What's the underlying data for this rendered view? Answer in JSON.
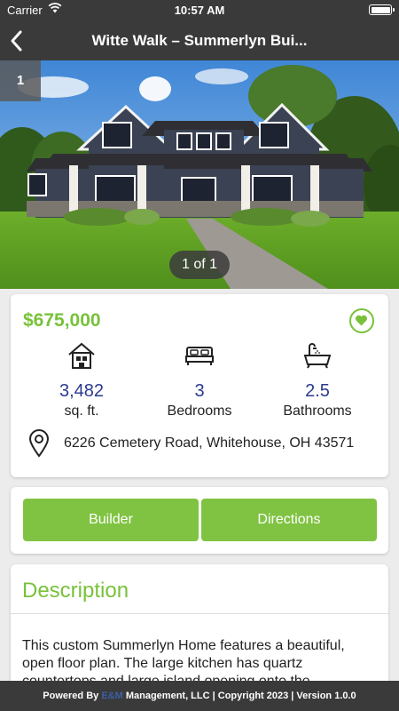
{
  "status_bar": {
    "carrier": "Carrier",
    "time": "10:57 AM"
  },
  "nav": {
    "title": "Witte Walk – Summerlyn Bui..."
  },
  "gallery": {
    "photo_count": "1",
    "pager": "1 of 1"
  },
  "listing": {
    "price": "$675,000",
    "stats": [
      {
        "icon": "house-icon",
        "value": "3,482",
        "label": "sq. ft."
      },
      {
        "icon": "bed-icon",
        "value": "3",
        "label": "Bedrooms"
      },
      {
        "icon": "bathtub-icon",
        "value": "2.5",
        "label": "Bathrooms"
      }
    ],
    "address": "6226 Cemetery Road, Whitehouse, OH 43571"
  },
  "actions": {
    "builder_label": "Builder",
    "directions_label": "Directions"
  },
  "description": {
    "title": "Description",
    "body": "This custom Summerlyn Home features a beautiful, open floor plan. The large kitchen has quartz countertops and large island opening onto the"
  },
  "footer": {
    "prefix": "Powered By ",
    "brand": "E&M",
    "suffix": " Management, LLC | Copyright 2023 | Version 1.0.0"
  },
  "colors": {
    "accent": "#78c23a",
    "button": "#80c342",
    "bar": "#3a3a3a",
    "stat_value": "#2b3a8f"
  }
}
